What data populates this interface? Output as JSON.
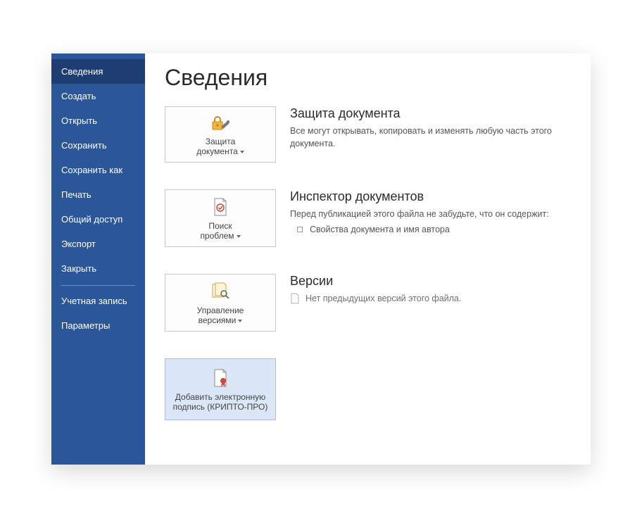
{
  "sidebar": {
    "items": [
      {
        "label": "Сведения",
        "selected": true
      },
      {
        "label": "Создать"
      },
      {
        "label": "Открыть"
      },
      {
        "label": "Сохранить"
      },
      {
        "label": "Сохранить как"
      },
      {
        "label": "Печать"
      },
      {
        "label": "Общий доступ"
      },
      {
        "label": "Экспорт"
      },
      {
        "label": "Закрыть"
      }
    ],
    "bottom": [
      {
        "label": "Учетная запись"
      },
      {
        "label": "Параметры"
      }
    ]
  },
  "page_title": "Сведения",
  "protection": {
    "tile_line1": "Защита",
    "tile_line2": "документа",
    "title": "Защита документа",
    "desc": "Все могут открывать, копировать и изменять любую часть этого документа."
  },
  "inspector": {
    "tile_line1": "Поиск",
    "tile_line2": "проблем",
    "title": "Инспектор документов",
    "desc": "Перед публикацией этого файла не забудьте, что он содержит:",
    "bullet": "Свойства документа и имя автора"
  },
  "versions": {
    "tile_line1": "Управление",
    "tile_line2": "версиями",
    "title": "Версии",
    "desc": "Нет предыдущих версий этого файла."
  },
  "sign": {
    "tile_line1": "Добавить электронную",
    "tile_line2": "подпись (КРИПТО-ПРО)"
  }
}
